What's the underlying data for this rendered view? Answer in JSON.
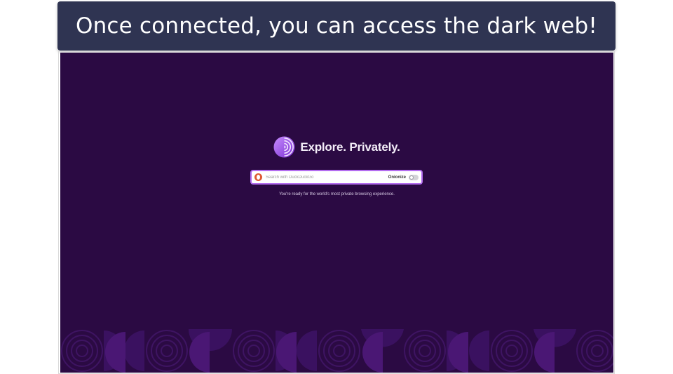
{
  "caption": "Once connected, you can access the dark web!",
  "page": {
    "hero_title": "Explore. Privately.",
    "search": {
      "placeholder": "Search with DuckDuckGo",
      "value": ""
    },
    "onionize_label": "Onionize",
    "onionize_enabled": false,
    "tagline": "You're ready for the world's most private browsing experience."
  },
  "icons": {
    "logo": "tor-onion-logo-icon",
    "search_engine": "duckduckgo-icon"
  },
  "colors": {
    "background": "#2b0a43",
    "accent": "#b46df0",
    "banner": "#2f3452"
  }
}
